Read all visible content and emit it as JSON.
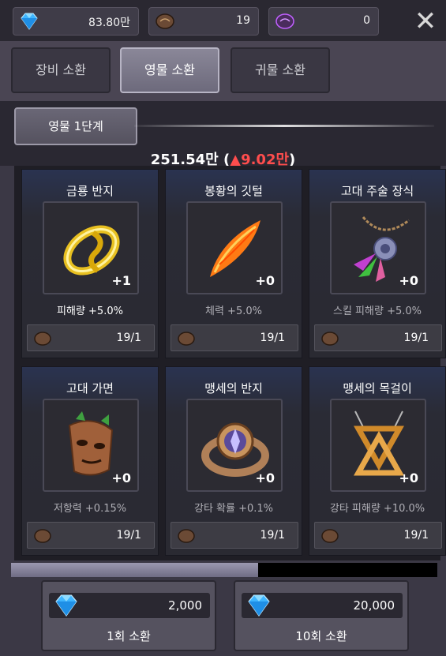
{
  "currencies": [
    {
      "icon": "diamond-icon",
      "value": "83.80만"
    },
    {
      "icon": "spirit-stone-icon",
      "value": "19"
    },
    {
      "icon": "purple-stone-icon",
      "value": "0"
    }
  ],
  "close_label": "✕",
  "tabs": [
    {
      "label": "장비 소환",
      "active": false
    },
    {
      "label": "영물 소환",
      "active": true
    },
    {
      "label": "귀물 소환",
      "active": false
    }
  ],
  "level_tab": "영물 1단계",
  "power": {
    "value": "251.54만 (",
    "up_arrow": "▲",
    "up_value": "9.02만",
    "close_paren": ")"
  },
  "items": [
    {
      "name": "금룡 반지",
      "level": "+1",
      "stat": "피해량 +5.0%",
      "count": "19/1",
      "icon": "gold-ring-icon"
    },
    {
      "name": "봉황의 깃털",
      "level": "+0",
      "stat": "체력 +5.0%",
      "count": "19/1",
      "icon": "phoenix-feather-icon"
    },
    {
      "name": "고대 주술 장식",
      "level": "+0",
      "stat": "스킬 피해량 +5.0%",
      "count": "19/1",
      "icon": "feather-necklace-icon"
    },
    {
      "name": "고대 가면",
      "level": "+0",
      "stat": "저항력 +0.15%",
      "count": "19/1",
      "icon": "wooden-mask-icon"
    },
    {
      "name": "맹세의 반지",
      "level": "+0",
      "stat": "강타 확률 +0.1%",
      "count": "19/1",
      "icon": "oath-ring-icon"
    },
    {
      "name": "맹세의 목걸이",
      "level": "+0",
      "stat": "강타 피해량 +10.0%",
      "count": "19/1",
      "icon": "oath-necklace-icon"
    }
  ],
  "progress": {
    "fraction": 0.58
  },
  "summon_buttons": [
    {
      "cost": "2,000",
      "label": "1회 소환"
    },
    {
      "cost": "20,000",
      "label": "10회 소환"
    }
  ],
  "colors": {
    "accent_up": "#ff4d4d",
    "gem": "#3fb6ff"
  }
}
